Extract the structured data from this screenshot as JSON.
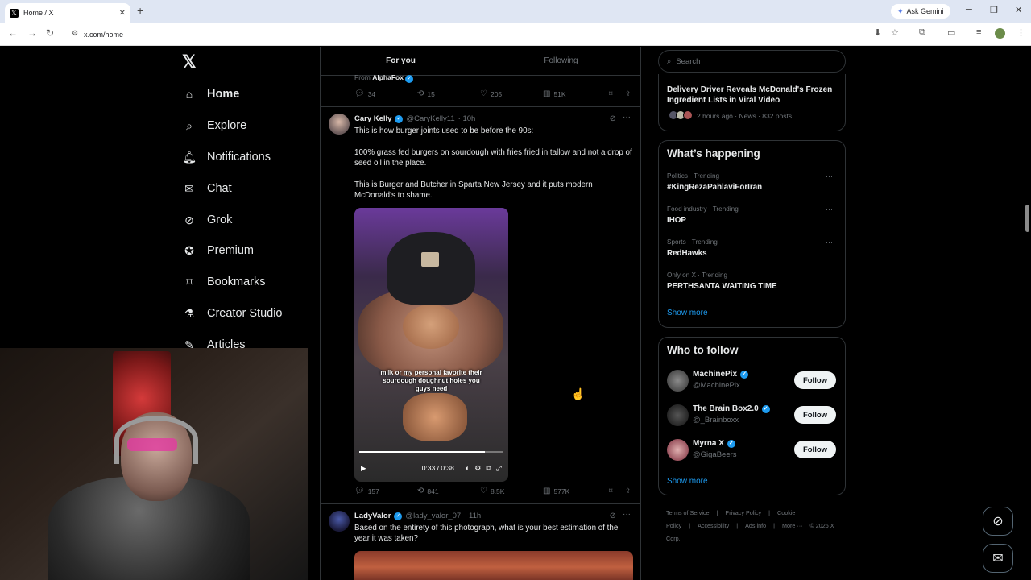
{
  "browser": {
    "tab_title": "Home / X",
    "url": "x.com/home",
    "ask_gemini": "Ask Gemini"
  },
  "nav": {
    "items": [
      {
        "label": "Home",
        "icon": "home-icon"
      },
      {
        "label": "Explore",
        "icon": "search-icon"
      },
      {
        "label": "Notifications",
        "icon": "bell-icon"
      },
      {
        "label": "Chat",
        "icon": "mail-icon"
      },
      {
        "label": "Grok",
        "icon": "grok-icon"
      },
      {
        "label": "Premium",
        "icon": "verified-icon"
      },
      {
        "label": "Bookmarks",
        "icon": "bookmark-icon"
      },
      {
        "label": "Creator Studio",
        "icon": "flask-icon"
      },
      {
        "label": "Articles",
        "icon": "articles-icon"
      }
    ]
  },
  "timeline": {
    "tabs": [
      "For you",
      "Following"
    ],
    "prev_post": {
      "from_prefix": "From",
      "from_name": "AlphaFox",
      "replies": "34",
      "reposts": "15",
      "likes": "205",
      "views": "51K"
    },
    "post1": {
      "name": "Cary Kelly",
      "handle": "@CaryKelly11",
      "time": "· 10h",
      "text1": "This is how burger joints used to be before the 90s:",
      "text2": "100% grass fed burgers on sourdough with fries fried in tallow and not a drop of seed oil in the place.",
      "text3": "This is Burger and Butcher in Sparta New Jersey and it puts modern McDonald's to shame.",
      "video_caption": "milk or my personal favorite their sourdough doughnut holes you guys need",
      "video_time": "0:33 / 0:38",
      "video_progress": 0.87,
      "replies": "157",
      "reposts": "841",
      "likes": "8.5K",
      "views": "577K"
    },
    "post2": {
      "name": "LadyValor",
      "handle": "@lady_valor_07",
      "time": "· 11h",
      "text": "Based on the entirety of this photograph, what is your best estimation of the year it was taken?"
    }
  },
  "sidebar": {
    "search_placeholder": "Search",
    "news": {
      "title": "Delivery Driver Reveals McDonald's Frozen Ingredient Lists in Viral Video",
      "meta": "2 hours ago · News · 832 posts"
    },
    "whats_happening": {
      "title": "What’s happening",
      "trends": [
        {
          "context": "Politics · Trending",
          "name": "#KingRezaPahlaviForIran"
        },
        {
          "context": "Food industry · Trending",
          "name": "IHOP"
        },
        {
          "context": "Sports · Trending",
          "name": "RedHawks"
        },
        {
          "context": "Only on X · Trending",
          "name": "PERTHSANTA WAITING TIME"
        }
      ],
      "show_more": "Show more"
    },
    "who_to_follow": {
      "title": "Who to follow",
      "accounts": [
        {
          "name": "MachinePix",
          "handle": "@MachinePix",
          "button": "Follow"
        },
        {
          "name": "The Brain Box2.0",
          "handle": "@_Brainboxx",
          "button": "Follow"
        },
        {
          "name": "Myrna X",
          "handle": "@GigaBeers",
          "button": "Follow"
        }
      ],
      "show_more": "Show more"
    },
    "footer": [
      "Terms of Service",
      "|",
      "Privacy Policy",
      "|",
      "Cookie Policy",
      "|",
      "Accessibility",
      "|",
      "Ads info",
      "|",
      "More ···",
      "© 2026 X Corp."
    ]
  }
}
